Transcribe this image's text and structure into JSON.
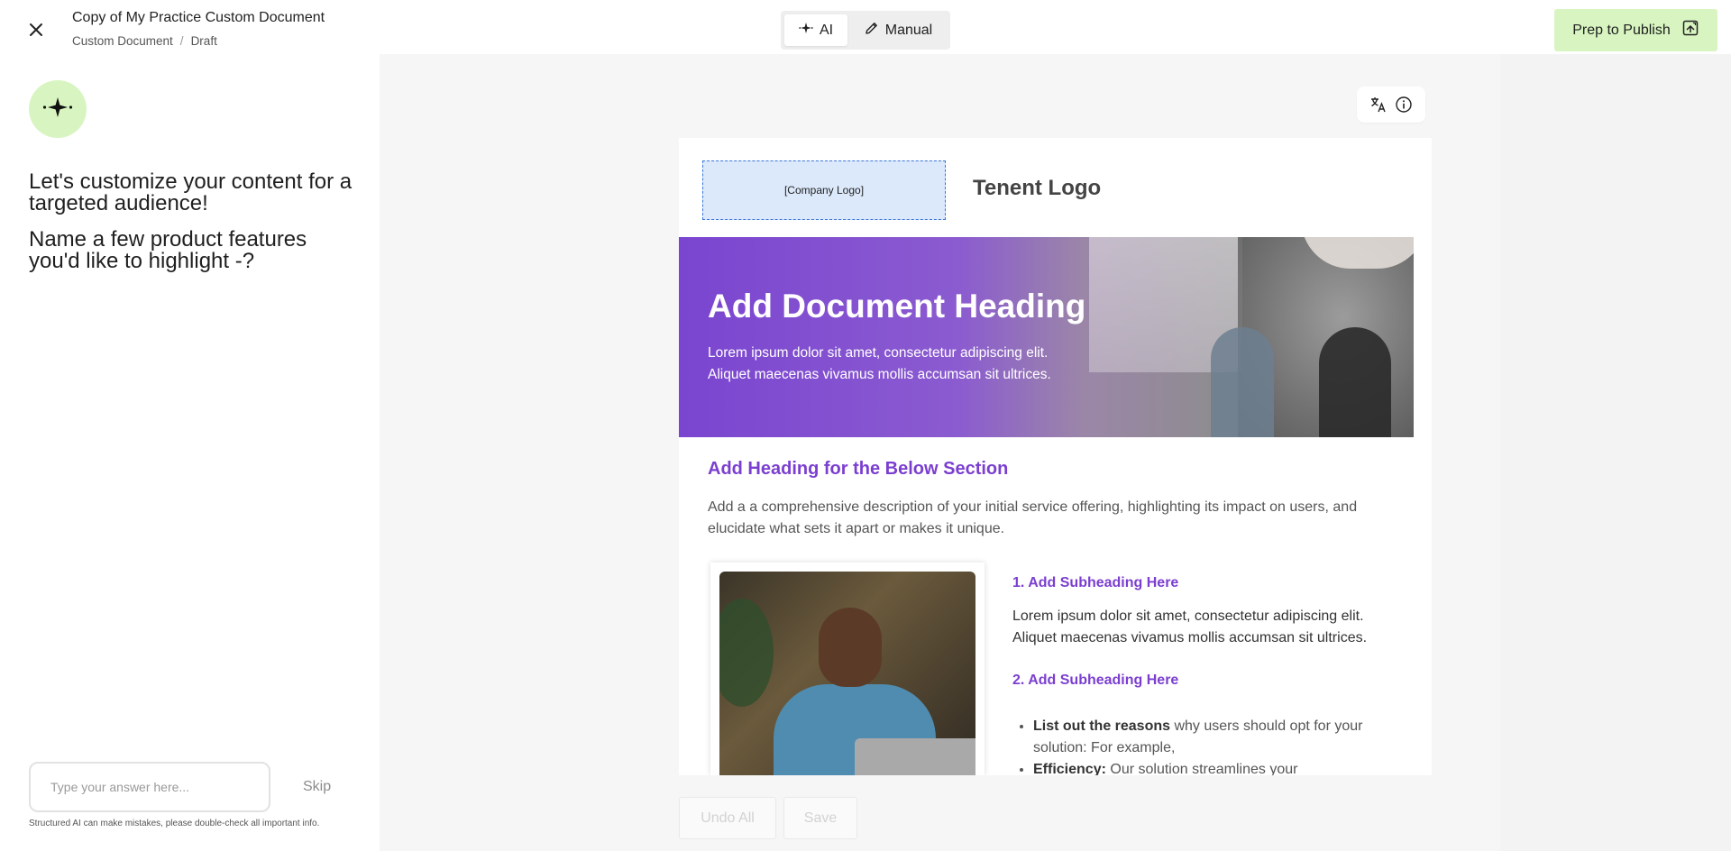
{
  "header": {
    "title": "Copy of My Practice Custom Document",
    "breadcrumb": [
      "Custom Document",
      "Draft"
    ],
    "modes": {
      "ai": "AI",
      "manual": "Manual"
    },
    "publish_label": "Prep to Publish"
  },
  "assistant": {
    "prompt_lines": [
      "Let's customize your content for a targeted audience!",
      "Name a few product features you'd like to highlight -?"
    ],
    "input_placeholder": "Type your answer here...",
    "skip_label": "Skip",
    "disclaimer": "Structured AI can make mistakes, please double-check all important info."
  },
  "document": {
    "company_logo_placeholder": "[Company Logo]",
    "tenant_logo": "Tenent Logo",
    "hero_title": "Add Document Heading",
    "hero_subtitle": "Lorem ipsum dolor sit amet, consectetur adipiscing elit. Aliquet maecenas vivamus mollis accumsan sit ultrices.",
    "section_heading": "Add Heading for the Below Section",
    "section_description": "Add a a comprehensive description of your initial service offering, highlighting its impact on users, and elucidate what sets it apart or makes it unique.",
    "subheading_1": "1. Add Subheading Here",
    "subheading_1_text": "Lorem ipsum dolor sit amet, consectetur adipiscing elit. Aliquet maecenas vivamus mollis accumsan sit ultrices.",
    "subheading_2": "2. Add Subheading Here",
    "bullets": [
      {
        "bold": "List out the reasons",
        "text": " why users should opt for your solution: For example,"
      },
      {
        "bold": "Efficiency:",
        "text": " Our solution streamlines your"
      }
    ]
  },
  "toolbar_icons": [
    "translate-icon",
    "info-icon"
  ],
  "actions": {
    "undo_all": "Undo All",
    "save": "Save"
  },
  "colors": {
    "accent_green": "#d8f5c1",
    "heading_purple": "#7b3fd0",
    "hero_purple": "#7a45d0"
  }
}
